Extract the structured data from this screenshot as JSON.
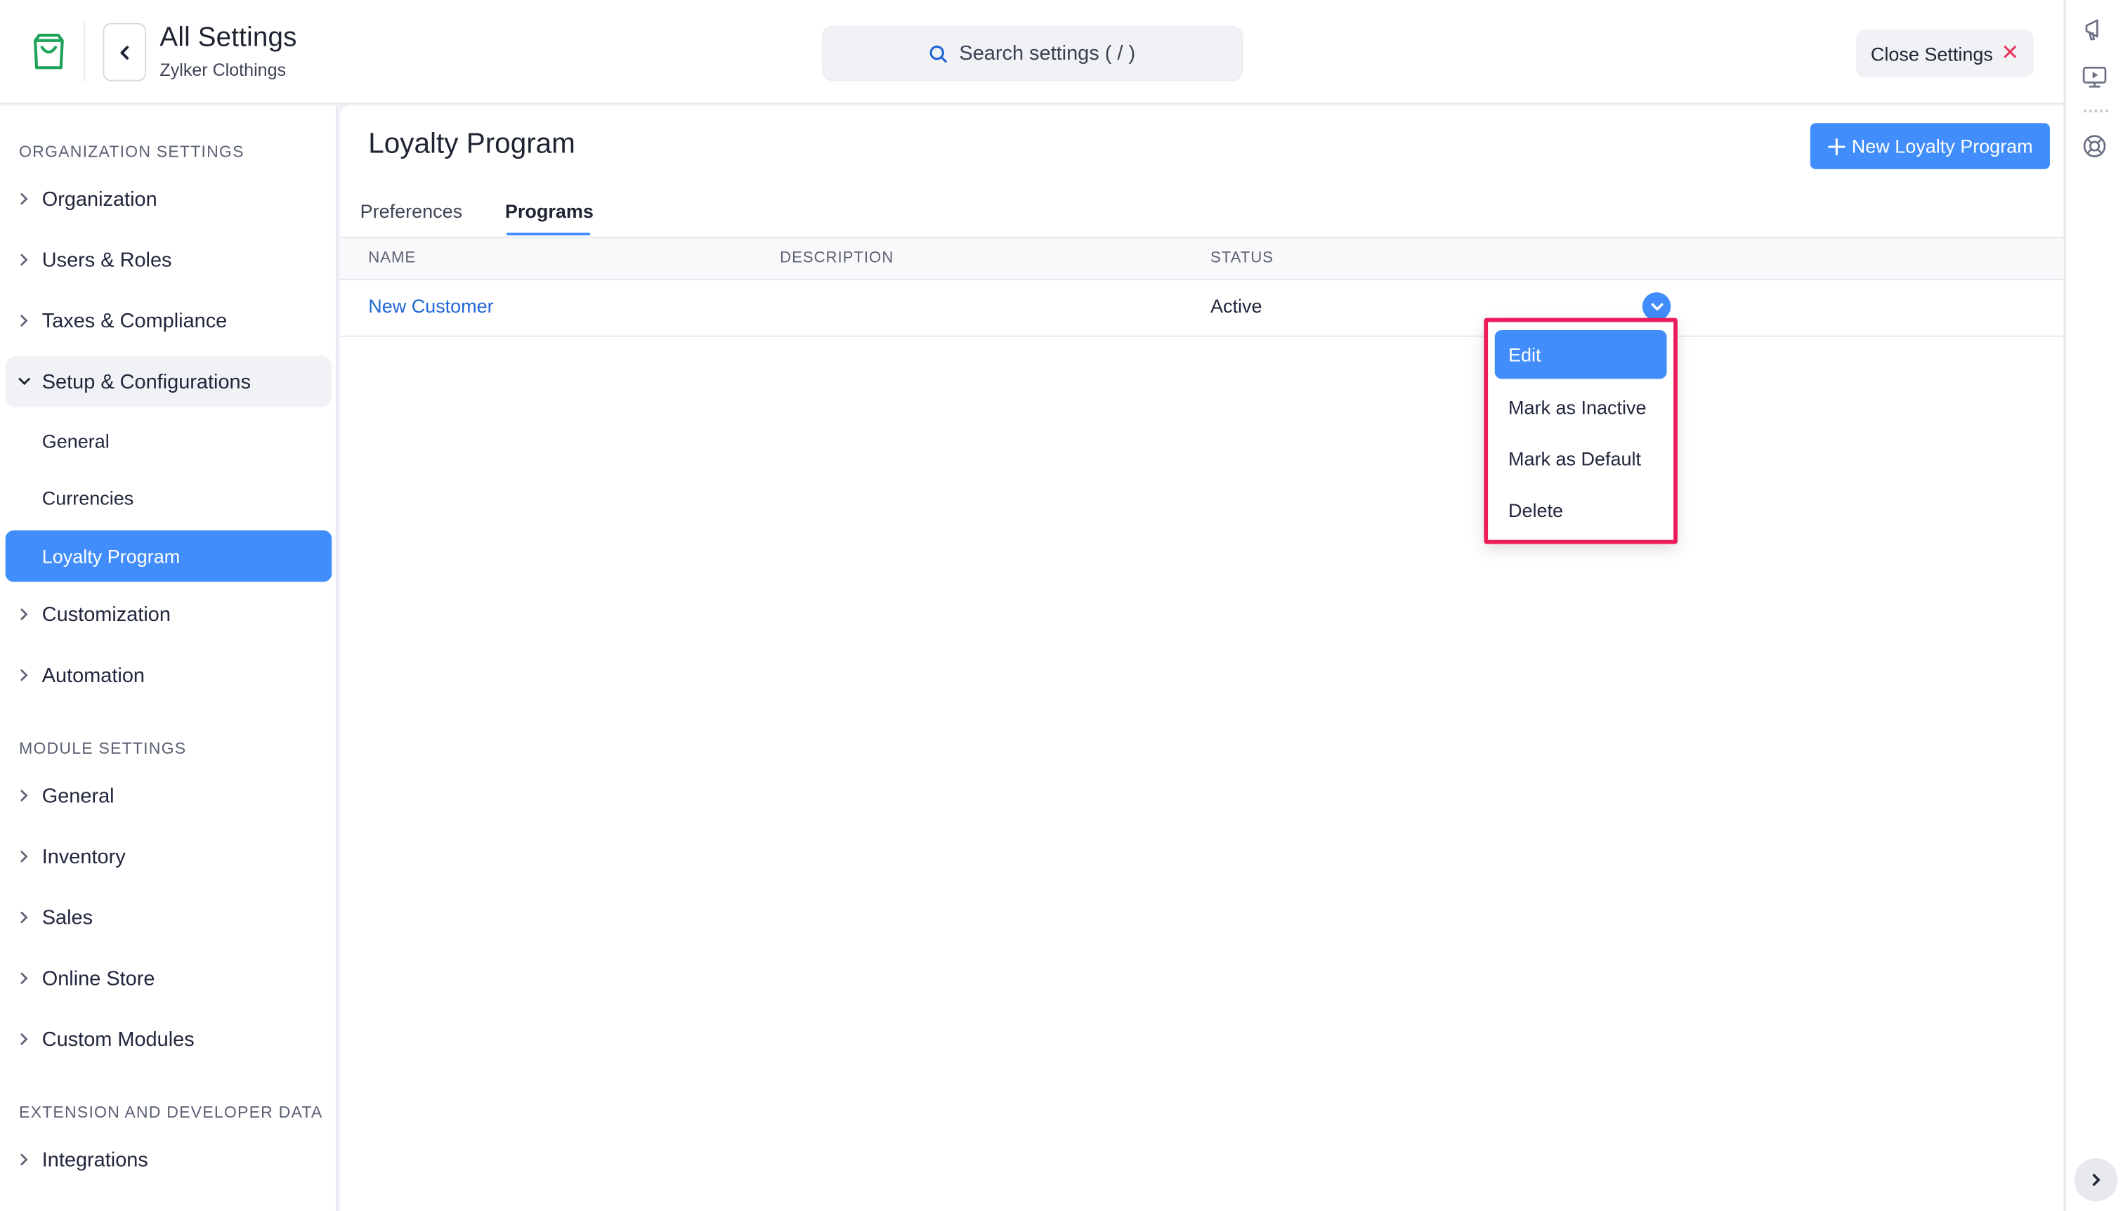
{
  "header": {
    "title": "All Settings",
    "subtitle": "Zylker Clothings",
    "search_placeholder": "Search settings ( / )",
    "close_label": "Close Settings"
  },
  "sidebar": {
    "org_heading": "ORGANIZATION SETTINGS",
    "org_items": [
      {
        "label": "Organization"
      },
      {
        "label": "Users & Roles"
      },
      {
        "label": "Taxes & Compliance"
      },
      {
        "label": "Setup & Configurations"
      }
    ],
    "setup_sub_items": [
      {
        "label": "General"
      },
      {
        "label": "Currencies"
      },
      {
        "label": "Loyalty Program"
      }
    ],
    "org_items_after": [
      {
        "label": "Customization"
      },
      {
        "label": "Automation"
      }
    ],
    "module_heading": "MODULE SETTINGS",
    "module_items": [
      {
        "label": "General"
      },
      {
        "label": "Inventory"
      },
      {
        "label": "Sales"
      },
      {
        "label": "Online Store"
      },
      {
        "label": "Custom Modules"
      }
    ],
    "ext_heading": "EXTENSION AND DEVELOPER DATA",
    "ext_items": [
      {
        "label": "Integrations"
      }
    ]
  },
  "main": {
    "title": "Loyalty Program",
    "new_button": "New Loyalty Program",
    "tabs": [
      {
        "label": "Preferences"
      },
      {
        "label": "Programs"
      }
    ],
    "columns": [
      "NAME",
      "DESCRIPTION",
      "STATUS"
    ],
    "rows": [
      {
        "name": "New Customer",
        "description": "",
        "status": "Active"
      }
    ],
    "row_menu": [
      {
        "label": "Edit"
      },
      {
        "label": "Mark as Inactive"
      },
      {
        "label": "Mark as Default"
      },
      {
        "label": "Delete"
      }
    ]
  },
  "colors": {
    "accent": "#408dfb",
    "link": "#1f66d6",
    "highlight_border": "#ec1c5b",
    "close_icon": "#e4365b"
  }
}
